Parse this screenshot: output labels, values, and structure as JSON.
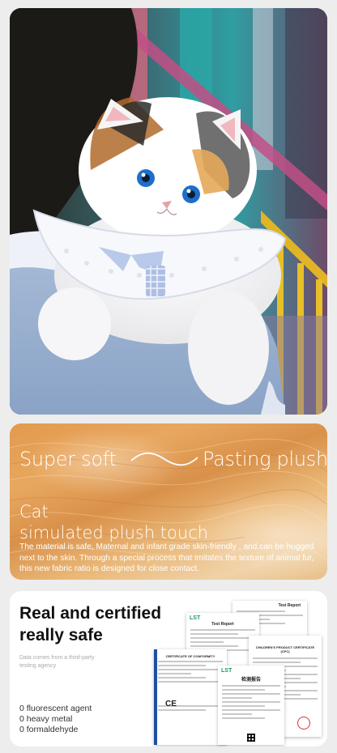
{
  "plush": {
    "headline_left": "Super soft",
    "headline_right": "Pasting plush",
    "title_line1": "Cat",
    "title_line2": "simulated plush touch",
    "body": "The material is safe, Maternal and infant grade skin-friendly , and can be hugged next to the skin. Through a special process that imitates the texture of animal fur, this new fabric ratio is designed for close contact."
  },
  "cert": {
    "heading_line1": "Real and certified",
    "heading_line2": "really safe",
    "note": "Data comes from a third-party testing agency",
    "items": [
      "0 fluorescent agent",
      "0 heavy metal",
      "0 formaldehyde"
    ],
    "doc_titles": {
      "report1": "Test Report",
      "report2": "Test Report",
      "children": "CHILDREN'S PRODUCT CERTIFICATE (CPC)",
      "conformity": "CERTIFICATE OF CONFORMITY",
      "cn_report": "检测报告",
      "lst": "LST",
      "ce": "CE"
    }
  },
  "colors": {
    "background": "#ededed",
    "plush_orange": "#e29a4e",
    "cert_green": "#1a9a5a"
  }
}
